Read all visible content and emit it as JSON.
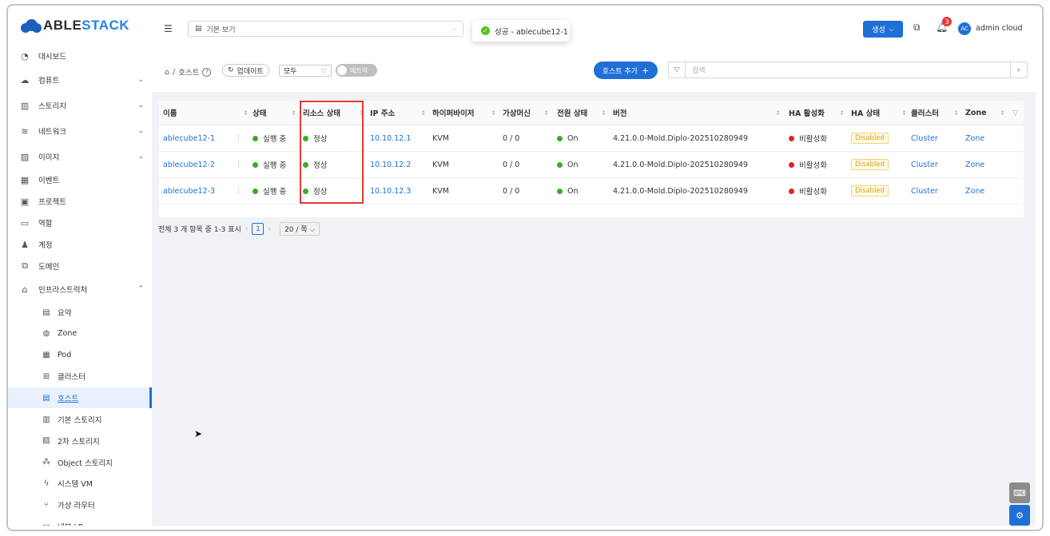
{
  "brand": {
    "part1": "ABLE",
    "part2": "STACK"
  },
  "sidebar": {
    "items": [
      {
        "label": "대시보드",
        "icon": "dashboard-icon"
      },
      {
        "label": "컴퓨트",
        "icon": "cloud-icon",
        "expand": "⌄"
      },
      {
        "label": "스토리지",
        "icon": "storage-icon",
        "expand": "⌄"
      },
      {
        "label": "네트워크",
        "icon": "wifi-icon",
        "expand": "⌄"
      },
      {
        "label": "이미지",
        "icon": "image-icon",
        "expand": "⌄"
      },
      {
        "label": "이벤트",
        "icon": "calendar-icon"
      },
      {
        "label": "프로젝트",
        "icon": "project-icon"
      },
      {
        "label": "역할",
        "icon": "id-card-icon"
      },
      {
        "label": "계정",
        "icon": "users-icon"
      },
      {
        "label": "도메인",
        "icon": "domain-icon"
      },
      {
        "label": "인프라스트럭처",
        "icon": "bank-icon",
        "expand": "⌃"
      }
    ],
    "sub_items": [
      {
        "label": "요약",
        "icon": "summary-icon"
      },
      {
        "label": "Zone",
        "icon": "globe-icon"
      },
      {
        "label": "Pod",
        "icon": "appstore-icon"
      },
      {
        "label": "클러스터",
        "icon": "cluster-icon"
      },
      {
        "label": "호스트",
        "icon": "host-icon",
        "active": true
      },
      {
        "label": "기본 스토리지",
        "icon": "database-icon"
      },
      {
        "label": "2차 스토리지",
        "icon": "picture-icon"
      },
      {
        "label": "Object 스토리지",
        "icon": "gold-icon"
      },
      {
        "label": "시스템 VM",
        "icon": "thunderbolt-icon"
      },
      {
        "label": "가상 라우터",
        "icon": "fork-icon"
      },
      {
        "label": "내부 LB",
        "icon": "share-icon"
      }
    ]
  },
  "header": {
    "view_select": "기본 보기",
    "toast": "성공 - ablecube12-1",
    "create_label": "생성",
    "notification_count": "3",
    "avatar_initials": "AC",
    "user_name": "admin cloud"
  },
  "toolbar": {
    "crumb_home": "⌂",
    "crumb_sep": "/",
    "crumb_page": "호스트",
    "refresh_label": "업데이트",
    "filter_value": "모두",
    "metrics_label": "메트릭",
    "add_host_label": "호스트 추가",
    "search_placeholder": "검색"
  },
  "table": {
    "columns": [
      "이름",
      "상태",
      "리소스 상태",
      "IP 주소",
      "하이퍼바이저",
      "가상머신",
      "전원 상태",
      "버전",
      "HA 활성화",
      "HA 상태",
      "클러스터",
      "Zone"
    ],
    "rows": [
      {
        "name": "ablecube12-1",
        "state": "실행 중",
        "resource_state": "정상",
        "ip": "10.10.12.1",
        "hypervisor": "KVM",
        "vms": "0 / 0",
        "power": "On",
        "version": "4.21.0.0-Mold.Diplo-202510280949",
        "ha_enabled": "비활성화",
        "ha_state": "Disabled",
        "cluster": "Cluster",
        "zone": "Zone"
      },
      {
        "name": "ablecube12-2",
        "state": "실행 중",
        "resource_state": "정상",
        "ip": "10.10.12.2",
        "hypervisor": "KVM",
        "vms": "0 / 0",
        "power": "On",
        "version": "4.21.0.0-Mold.Diplo-202510280949",
        "ha_enabled": "비활성화",
        "ha_state": "Disabled",
        "cluster": "Cluster",
        "zone": "Zone"
      },
      {
        "name": "ablecube12-3",
        "state": "실행 중",
        "resource_state": "정상",
        "ip": "10.10.12.3",
        "hypervisor": "KVM",
        "vms": "0 / 0",
        "power": "On",
        "version": "4.21.0.0-Mold.Diplo-202510280949",
        "ha_enabled": "비활성화",
        "ha_state": "Disabled",
        "cluster": "Cluster",
        "zone": "Zone"
      }
    ]
  },
  "pagination": {
    "summary": "전체 3 개 항목 중 1-3 표시",
    "current_page": "1",
    "page_size": "20 / 쪽"
  },
  "colors": {
    "primary": "#1f6fd6",
    "success": "#3fa927",
    "danger": "#e02424",
    "highlight": "#e53935"
  }
}
